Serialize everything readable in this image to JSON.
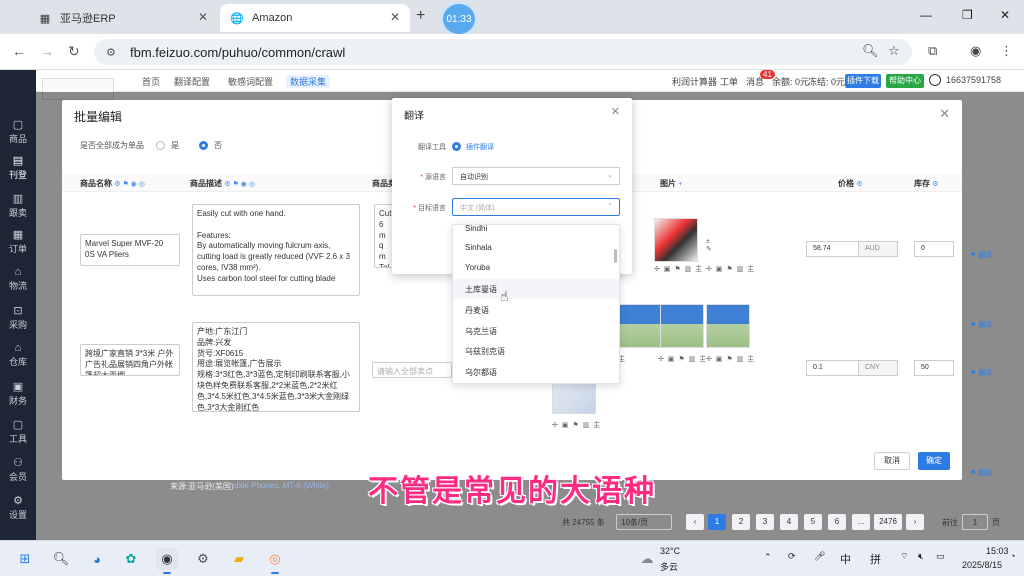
{
  "browser": {
    "tabs": [
      {
        "title": "亚马逊ERP",
        "active": false
      },
      {
        "title": "Amazon",
        "active": true
      }
    ],
    "timer": "01:33",
    "url": "fbm.feizuo.com/puhuo/common/crawl"
  },
  "sidebar": {
    "items": [
      {
        "label": "商品",
        "icon": "box-icon"
      },
      {
        "label": "刊登",
        "icon": "publish-icon"
      },
      {
        "label": "跟卖",
        "icon": "follow-icon"
      },
      {
        "label": "订单",
        "icon": "order-icon"
      },
      {
        "label": "物流",
        "icon": "truck-icon"
      },
      {
        "label": "采购",
        "icon": "cart-icon"
      },
      {
        "label": "仓库",
        "icon": "warehouse-icon"
      },
      {
        "label": "财务",
        "icon": "finance-icon"
      },
      {
        "label": "工具",
        "icon": "tool-icon"
      },
      {
        "label": "会员",
        "icon": "member-icon"
      },
      {
        "label": "设置",
        "icon": "gear-icon"
      }
    ]
  },
  "topnav": {
    "tabs": [
      "首页",
      "翻译配置",
      "敏感词配置",
      "数据采集"
    ],
    "active_tab": "数据采集",
    "right": {
      "profit_calc": "利润计算器",
      "ticket": "工单",
      "messages": "消息",
      "message_count": "41",
      "balance": "余额: 0元",
      "frozen": "冻结: 0元",
      "plugin": "插件下载",
      "help": "帮助中心",
      "phone": "16637591758"
    }
  },
  "batch_modal": {
    "title": "批量编辑",
    "translate_all_label": "是否全部成为单品",
    "opt_yes": "是",
    "opt_no": "否",
    "columns": [
      "商品名称",
      "商品描述",
      "商品卖点",
      "图片",
      "价格",
      "库存"
    ],
    "rows": [
      {
        "name": "Marvel Super MVF-20 0S VA Pliers",
        "desc": "Easily cut with one hand.\n\nFeatures:\nBy automatically moving fulcrum axis, cutting load is greatly reduced (VVF 2.6 x 3 cores, IV38 mm²).\nUses carbon tool steel for cutting blade",
        "point": "Cut\n6 m\nq m\nTol\nWe",
        "price": "58.74",
        "currency": "AUD",
        "stock": "0"
      },
      {
        "name": "跨境广家直销 3*3米 户外广告礼品展销四角户外帐篷超大雨棚",
        "desc": "产地:广东江门\n品牌:兴发\n货号:XF0615\n用途:展览帐篷,广告展示\n规格:3*3红色,3*3蓝色,定制印刷联系客服,小块色样免费联系客服,2*2米蓝色,2*2米红色,3*4.5米红色,3*4.5米蓝色,3*3米大金刚绿色,3*3大金刚红色",
        "point_placeholder": "请输入全部卖点",
        "price": "0.1",
        "currency": "CNY",
        "stock": "50"
      }
    ],
    "translate_label": "翻译",
    "cancel": "取消",
    "confirm": "确定"
  },
  "translate_modal": {
    "title": "翻译",
    "tool_label": "翻译工具",
    "tool_value": "插件翻译",
    "source_label": "源语言",
    "source_value": "自动识别",
    "target_label": "目标语言",
    "target_placeholder": "中文 (简体)",
    "options": [
      "Sindhi",
      "Sinhala",
      "Yoruba",
      "土库曼语",
      "丹麦语",
      "乌克兰语",
      "乌兹别克语",
      "乌尔都语"
    ],
    "hovered": "土库曼语"
  },
  "background": {
    "source_label": "来源:亚马逊(美国)",
    "product_link": "obile Phones, MT-6 (White)"
  },
  "pagination": {
    "total": "共 24755 条",
    "page_size": "10条/页",
    "pages": [
      "1",
      "2",
      "3",
      "4",
      "5",
      "6",
      "...",
      "2476"
    ],
    "current": "1",
    "goto_label": "前往",
    "goto_value": "1",
    "page_unit": "页"
  },
  "subtitle": "不管是常见的大语种",
  "taskbar": {
    "weather_temp": "32°C",
    "weather_desc": "多云",
    "ime_lang": "中",
    "ime_mode": "拼",
    "time": "15:03",
    "date": "2025/8/15"
  }
}
